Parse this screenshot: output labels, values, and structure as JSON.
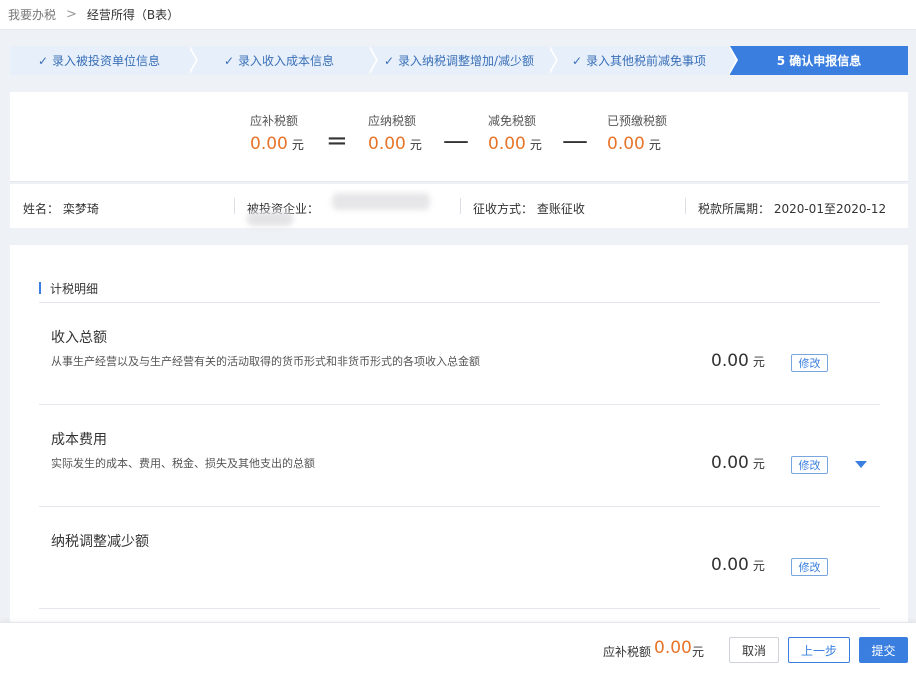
{
  "breadcrumb": {
    "first": "我要办税",
    "sep": ">",
    "current": "经营所得（B表）"
  },
  "steps": [
    {
      "check": "✓",
      "label": "录入被投资单位信息"
    },
    {
      "check": "✓",
      "label": "录入收入成本信息"
    },
    {
      "check": "✓",
      "label": "录入纳税调整增加/减少额"
    },
    {
      "check": "✓",
      "label": "录入其他税前减免事项"
    },
    {
      "check": "",
      "label": "5 确认申报信息"
    }
  ],
  "summary": {
    "items": [
      {
        "label": "应补税额",
        "value": "0.00",
        "unit": "元"
      },
      {
        "label": "应纳税额",
        "value": "0.00",
        "unit": "元"
      },
      {
        "label": "减免税额",
        "value": "0.00",
        "unit": "元"
      },
      {
        "label": "已预缴税额",
        "value": "0.00",
        "unit": "元"
      }
    ],
    "ops": [
      "=",
      "—",
      "—"
    ]
  },
  "info": {
    "name": "姓名： 栾梦琦",
    "company": "被投资企业：",
    "method": "征收方式： 查账征收",
    "period": "税款所属期： 2020-01至2020-12"
  },
  "details": {
    "title": "计税明细",
    "rows": [
      {
        "title": "收入总额",
        "desc": "从事生产经营以及与生产经营有关的活动取得的货币形式和非货币形式的各项收入总金额",
        "amount": "0.00",
        "unit": "元",
        "edit": "修改"
      },
      {
        "title": "成本费用",
        "desc": "实际发生的成本、费用、税金、损失及其他支出的总额",
        "amount": "0.00",
        "unit": "元",
        "edit": "修改"
      },
      {
        "title": "纳税调整减少额",
        "desc": "",
        "amount": "0.00",
        "unit": "元",
        "edit": "修改"
      }
    ]
  },
  "footer": {
    "label": "应补税额",
    "value": "0.00",
    "unit": "元",
    "cancel": "取消",
    "prev": "上一步",
    "submit": "提交"
  },
  "colors": {
    "accent": "#3a7fe0",
    "amount": "#e8742a",
    "step_bg": "#e7f0fa"
  },
  "icons": {
    "step_check": "check-icon",
    "expand": "caret-down-icon"
  }
}
